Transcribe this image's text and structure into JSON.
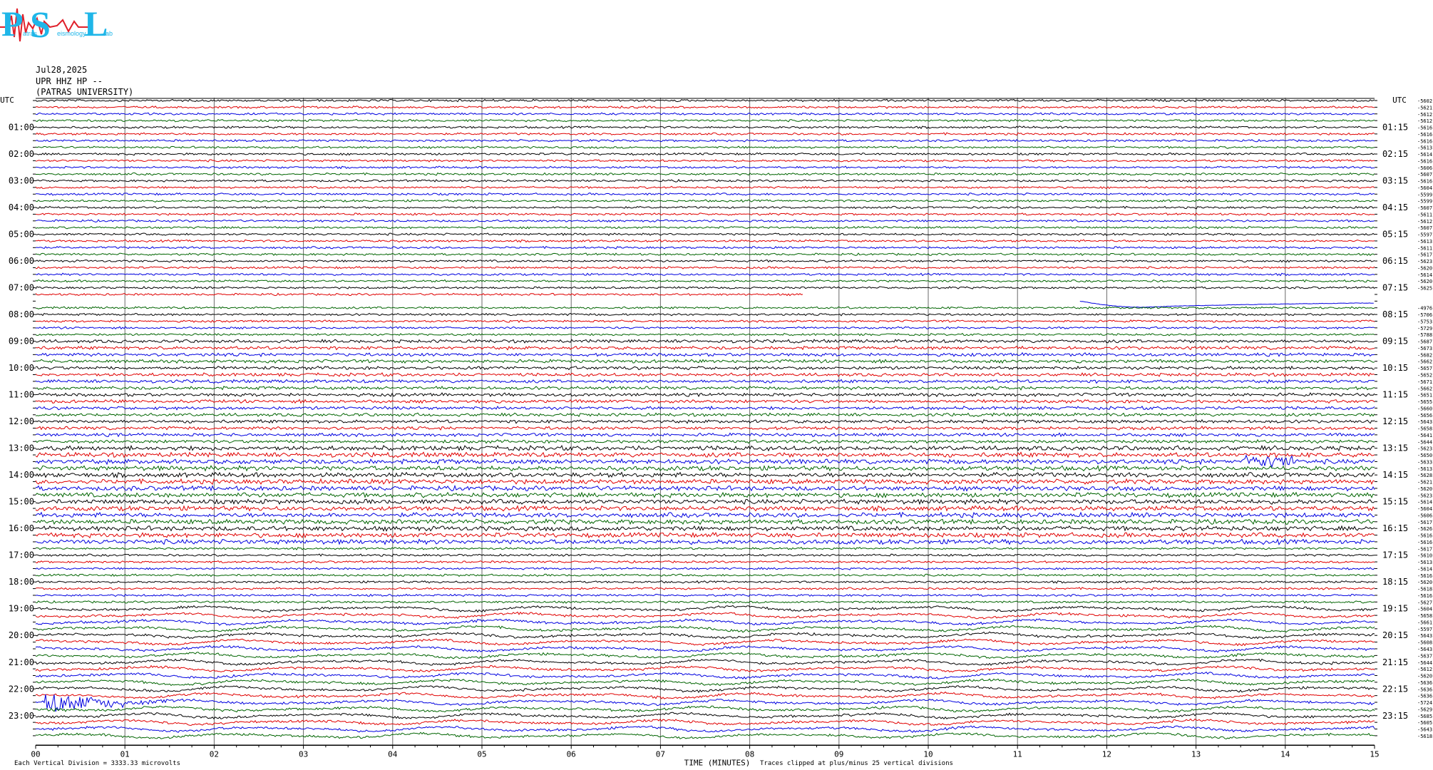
{
  "logo": {
    "letters": [
      "P",
      "S",
      "L"
    ],
    "words": [
      "atras",
      "eismology",
      "ab"
    ],
    "colors": {
      "letters": "#1fb6e8",
      "signal": "#e0202a"
    }
  },
  "header": {
    "date": "Jul28,2025",
    "station": "UPR HHZ HP --",
    "institution": "(PATRAS UNIVERSITY)"
  },
  "footer": {
    "left_note": "Each Vertical Division = 3333.33 microvolts",
    "x_axis_title": "TIME (MINUTES)",
    "right_note": "Traces clipped at plus/minus 25 vertical divisions"
  },
  "chart_data": {
    "type": "line",
    "title": "",
    "xlabel": "TIME (MINUTES)",
    "xlim": [
      0,
      15
    ],
    "x_ticks": [
      "00",
      "01",
      "02",
      "03",
      "04",
      "05",
      "06",
      "07",
      "08",
      "09",
      "10",
      "11",
      "12",
      "13",
      "14",
      "15"
    ],
    "left_axis_title": "UTC",
    "right_axis_title": "UTC",
    "rows_per_hour": 4,
    "row_minutes": 15,
    "left_hour_labels": [
      "01:00",
      "02:00",
      "03:00",
      "04:00",
      "05:00",
      "06:00",
      "07:00",
      "08:00",
      "09:00",
      "10:00",
      "11:00",
      "12:00",
      "13:00",
      "14:00",
      "15:00",
      "16:00",
      "17:00",
      "18:00",
      "19:00",
      "20:00",
      "21:00",
      "22:00",
      "23:00"
    ],
    "right_hour_labels": [
      "01:15",
      "02:15",
      "03:15",
      "04:15",
      "05:15",
      "06:15",
      "07:15",
      "08:15",
      "09:15",
      "10:15",
      "11:15",
      "12:15",
      "13:15",
      "14:15",
      "15:15",
      "16:15",
      "17:15",
      "18:15",
      "19:15",
      "20:15",
      "21:15",
      "22:15",
      "23:15"
    ],
    "trace_colors": [
      "#000000",
      "#e00000",
      "#0000e0",
      "#006400"
    ],
    "row_offsets": [
      "-5602",
      "-5621",
      "-5612",
      "-5612",
      "-5616",
      "-5616",
      "-5616",
      "-5613",
      "-5614",
      "-5616",
      "-5606",
      "-5607",
      "-5616",
      "-5604",
      "-5599",
      "-5599",
      "-5607",
      "-5611",
      "-5612",
      "-5607",
      "-5597",
      "-5613",
      "-5611",
      "-5617",
      "-5623",
      "-5620",
      "-5614",
      "-5620",
      "-5625",
      "",
      "",
      "-4976",
      "-5706",
      "-5753",
      "-5729",
      "-5788",
      "-5687",
      "-5673",
      "-5682",
      "-5662",
      "-5657",
      "-5652",
      "-5671",
      "-5662",
      "-5651",
      "-5655",
      "-5660",
      "-5656",
      "-5643",
      "-5658",
      "-5641",
      "-5644",
      "-5623",
      "-5650",
      "-5633",
      "-5613",
      "-5628",
      "-5621",
      "-5620",
      "-5623",
      "-5614",
      "-5604",
      "-5606",
      "-5617",
      "-5626",
      "-5616",
      "-5616",
      "-5617",
      "-5610",
      "-5613",
      "-5614",
      "-5616",
      "-5620",
      "-5618",
      "-5616",
      "-5627",
      "-5604",
      "-5658",
      "-5661",
      "-5597",
      "-5643",
      "-5608",
      "-5643",
      "-5637",
      "-5644",
      "-5612",
      "-5620",
      "-5636",
      "-5636",
      "-5636",
      "-5724",
      "-5629",
      "-5685",
      "-5605",
      "-5643",
      "-5618"
    ],
    "annotations": [
      {
        "text": "data gap",
        "row": 29,
        "from_minute": 8.6
      },
      {
        "text": "long-period transient",
        "row": 30,
        "from_minute": 11.7
      },
      {
        "text": "local event",
        "row": 90,
        "from_minute": 0.1,
        "to_minute": 2.2
      },
      {
        "text": "burst",
        "row": 54,
        "from_minute": 13.5,
        "to_minute": 14.1
      }
    ]
  }
}
